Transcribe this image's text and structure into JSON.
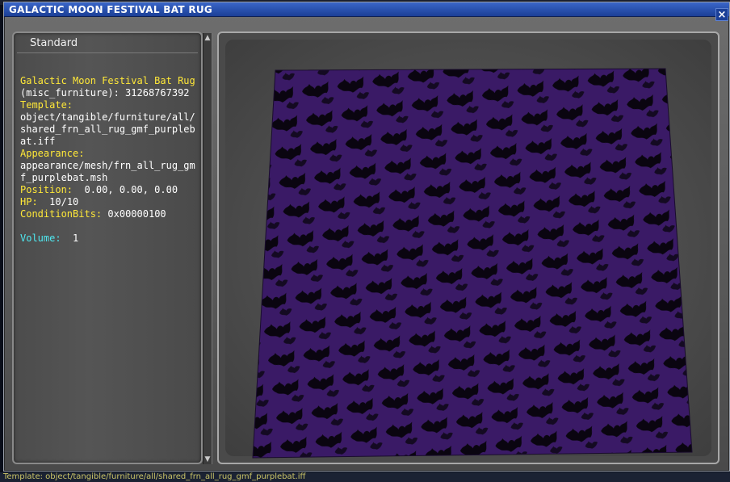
{
  "window": {
    "title": "GALACTIC MOON FESTIVAL BAT RUG",
    "close_symbol": "×"
  },
  "info_panel": {
    "tab_label": "Standard",
    "name": "Galactic Moon Festival Bat Rug",
    "id_line": "(misc_furniture): 31268767392",
    "template_label": "Template:",
    "template_value": "object/tangible/furniture/all/shared_frn_all_rug_gmf_purplebat.iff",
    "appearance_label": "Appearance:",
    "appearance_value": "appearance/mesh/frn_all_rug_gmf_purplebat.msh",
    "position_label": "Position:",
    "position_value": "0.00, 0.00, 0.00",
    "hp_label": "HP:",
    "hp_value": "10/10",
    "condition_label": "ConditionBits:",
    "condition_value": "0x00000100",
    "volume_label": "Volume:",
    "volume_value": "1"
  },
  "scrollbar": {
    "up_symbol": "▲",
    "down_symbol": "▼"
  },
  "background_bottom_text": "Template: object/tangible/furniture/all/shared_frn_all_rug_gmf_purplebat.iff",
  "colors": {
    "titlebar": "#2a52b0",
    "label_yellow": "#ffe838",
    "label_cyan": "#4fe8f0",
    "rug_purple": "#3a1a66",
    "rug_pattern": "#0a0510"
  },
  "icons": {
    "close": "close-icon",
    "scroll_up": "scroll-up-icon",
    "scroll_down": "scroll-down-icon"
  }
}
